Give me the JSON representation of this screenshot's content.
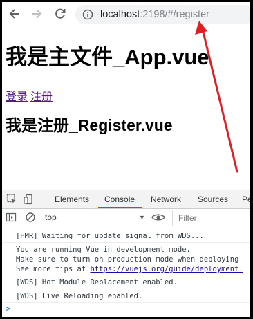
{
  "browser": {
    "url_host": "localhost",
    "url_rest": ":2198/#/register"
  },
  "page": {
    "heading_main": "我是主文件_App.vue",
    "link_login": "登录",
    "link_register": "注册",
    "heading_register": "我是注册_Register.vue"
  },
  "devtools": {
    "tabs": [
      "Elements",
      "Console",
      "Network",
      "Sources",
      "Pe"
    ],
    "active_tab": "Console",
    "context": "top",
    "filter_placeholder": "Filter",
    "messages": [
      {
        "lines": [
          "[HMR] Waiting for update signal from WDS..."
        ]
      },
      {
        "lines": [
          "You are running Vue in development mode.",
          "Make sure to turn on production mode when deploying",
          "See more tips at "
        ],
        "link": "https://vuejs.org/guide/deployment."
      },
      {
        "lines": [
          "[WDS] Hot Module Replacement enabled."
        ]
      },
      {
        "lines": [
          "[WDS] Live Reloading enabled."
        ]
      }
    ],
    "prompt_symbol": ">"
  },
  "colors": {
    "annotation_arrow": "#e02020",
    "link_visited": "#551a8b",
    "active_tab_underline": "#1a73e8"
  }
}
